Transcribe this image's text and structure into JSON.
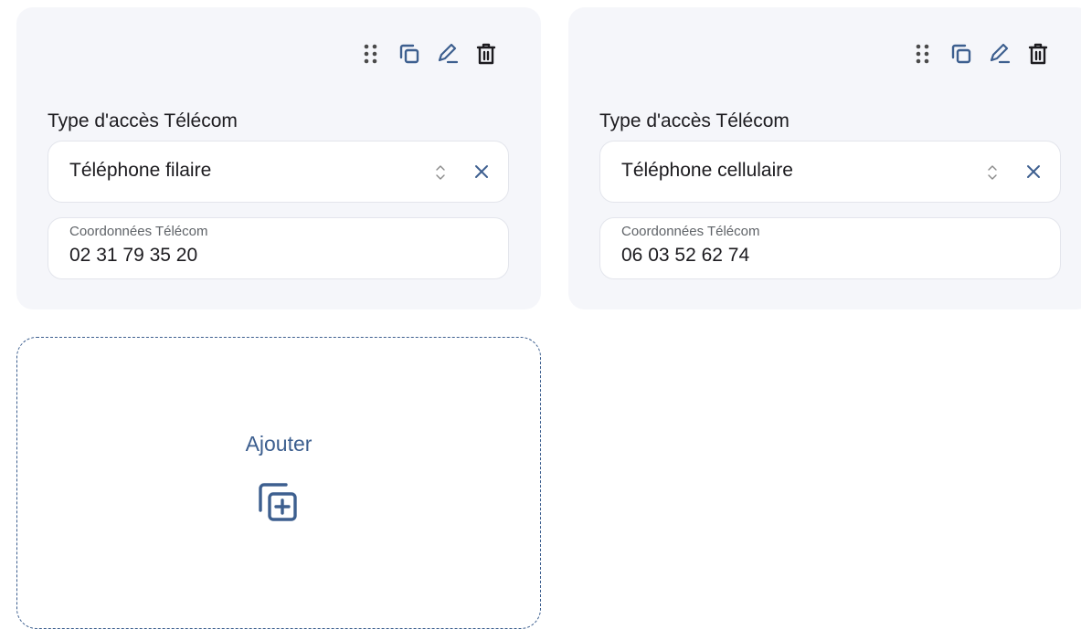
{
  "cards": [
    {
      "type_label": "Type d'accès Télécom",
      "type_value": "Téléphone filaire",
      "coord_label": "Coordonnées Télécom",
      "coord_value": "02 31 79 35 20"
    },
    {
      "type_label": "Type d'accès Télécom",
      "type_value": "Téléphone cellulaire",
      "coord_label": "Coordonnées Télécom",
      "coord_value": "06 03 52 62 74"
    }
  ],
  "toolbar_icons": [
    "drag-handle-icon",
    "duplicate-icon",
    "edit-icon",
    "delete-icon"
  ],
  "add_card": {
    "label": "Ajouter",
    "icon": "add-copy-icon"
  },
  "colors": {
    "accent": "#3d5f8f",
    "card_bg": "#f5f6fa",
    "field_bg": "#ffffff",
    "clear_icon": "#3d5f8f"
  }
}
